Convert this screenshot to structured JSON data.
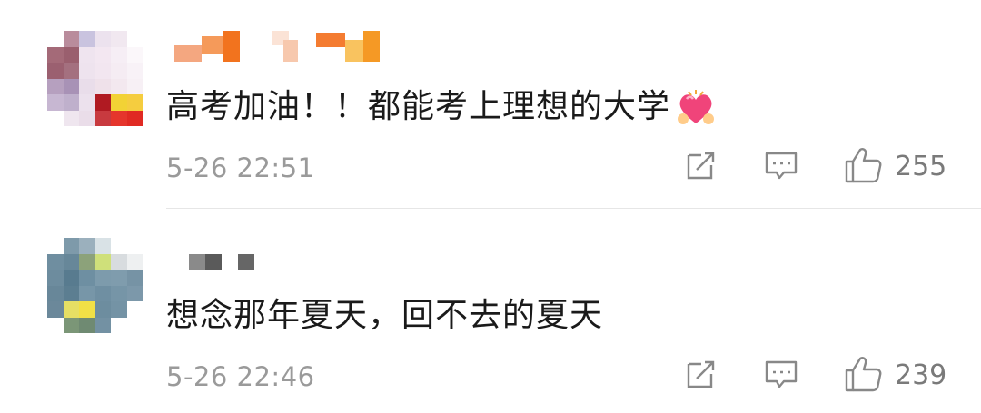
{
  "comments": [
    {
      "text": "高考加油！！都能考上理想的大学",
      "emoji": "heart-hands-emoji",
      "time": "5-26 22:51",
      "likes": "255",
      "icons": {
        "share": "share-icon",
        "comment": "comment-icon",
        "like": "thumbs-up-icon"
      }
    },
    {
      "text": "想念那年夏天，回不去的夏天",
      "time": "5-26 22:46",
      "likes": "239",
      "icons": {
        "share": "share-icon",
        "comment": "comment-icon",
        "like": "thumbs-up-icon"
      }
    }
  ]
}
